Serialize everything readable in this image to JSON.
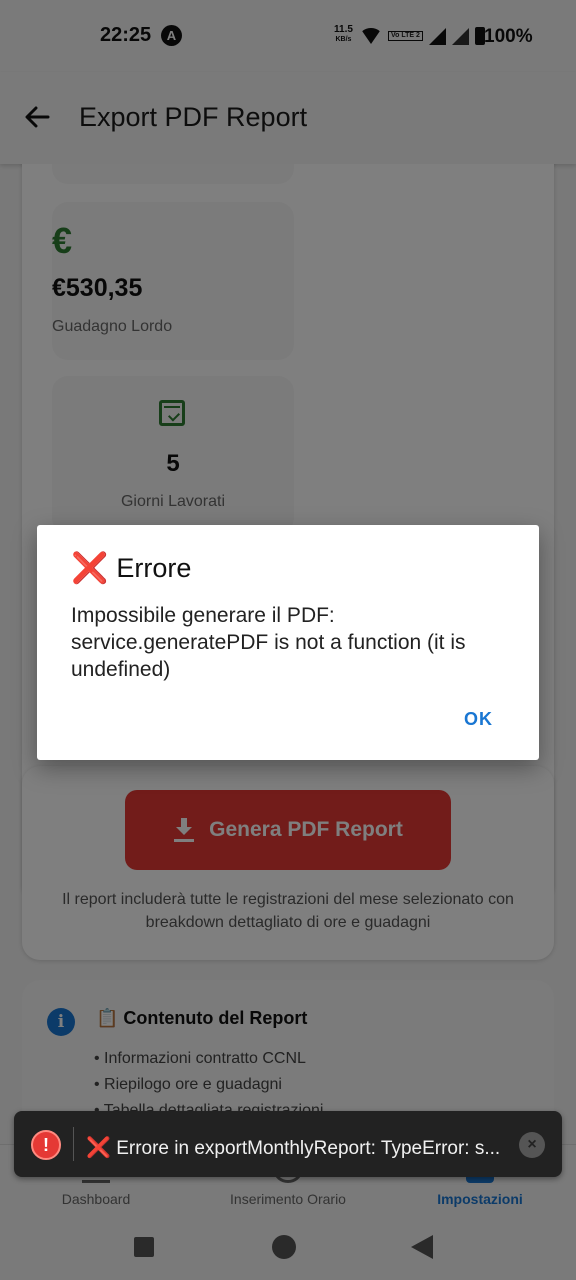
{
  "status_bar": {
    "time": "22:25",
    "app_icon": "A",
    "net_speed_value": "11.5",
    "net_speed_unit": "KB/s",
    "volte": "Vo LTE 2",
    "battery": "100%"
  },
  "app_bar": {
    "title": "Export PDF Report"
  },
  "stats": {
    "earnings_icon": "€",
    "earnings_value": "€530,35",
    "earnings_label": "Guadagno Lordo",
    "days_value": "5",
    "days_label": "Giorni Lavorati"
  },
  "generate": {
    "button_label": "Genera PDF Report",
    "note": "Il report includerà tutte le registrazioni del mese selezionato con breakdown dettagliato di ore e guadagni"
  },
  "info": {
    "icon": "i",
    "title": "📋 Contenuto del Report",
    "items": [
      "• Informazioni contratto CCNL",
      "• Riepilogo ore e guadagni",
      "• Tabella dettagliata registrazioni"
    ]
  },
  "bottom_nav": {
    "items": [
      {
        "label": "Dashboard"
      },
      {
        "label": "Inserimento Orario"
      },
      {
        "label": "Impostazioni"
      }
    ]
  },
  "dialog": {
    "icon": "❌",
    "title": "Errore",
    "message": "Impossibile generare il PDF: service.generatePDF is not a function (it is undefined)",
    "ok_label": "OK"
  },
  "toast": {
    "icon": "!",
    "prefix_icon": "❌",
    "message": "Errore in exportMonthlyReport: TypeError: s...",
    "close_icon": "×"
  },
  "colors": {
    "accent_blue": "#1976d2",
    "error_red": "#e53935",
    "success_green": "#2e7d32"
  }
}
